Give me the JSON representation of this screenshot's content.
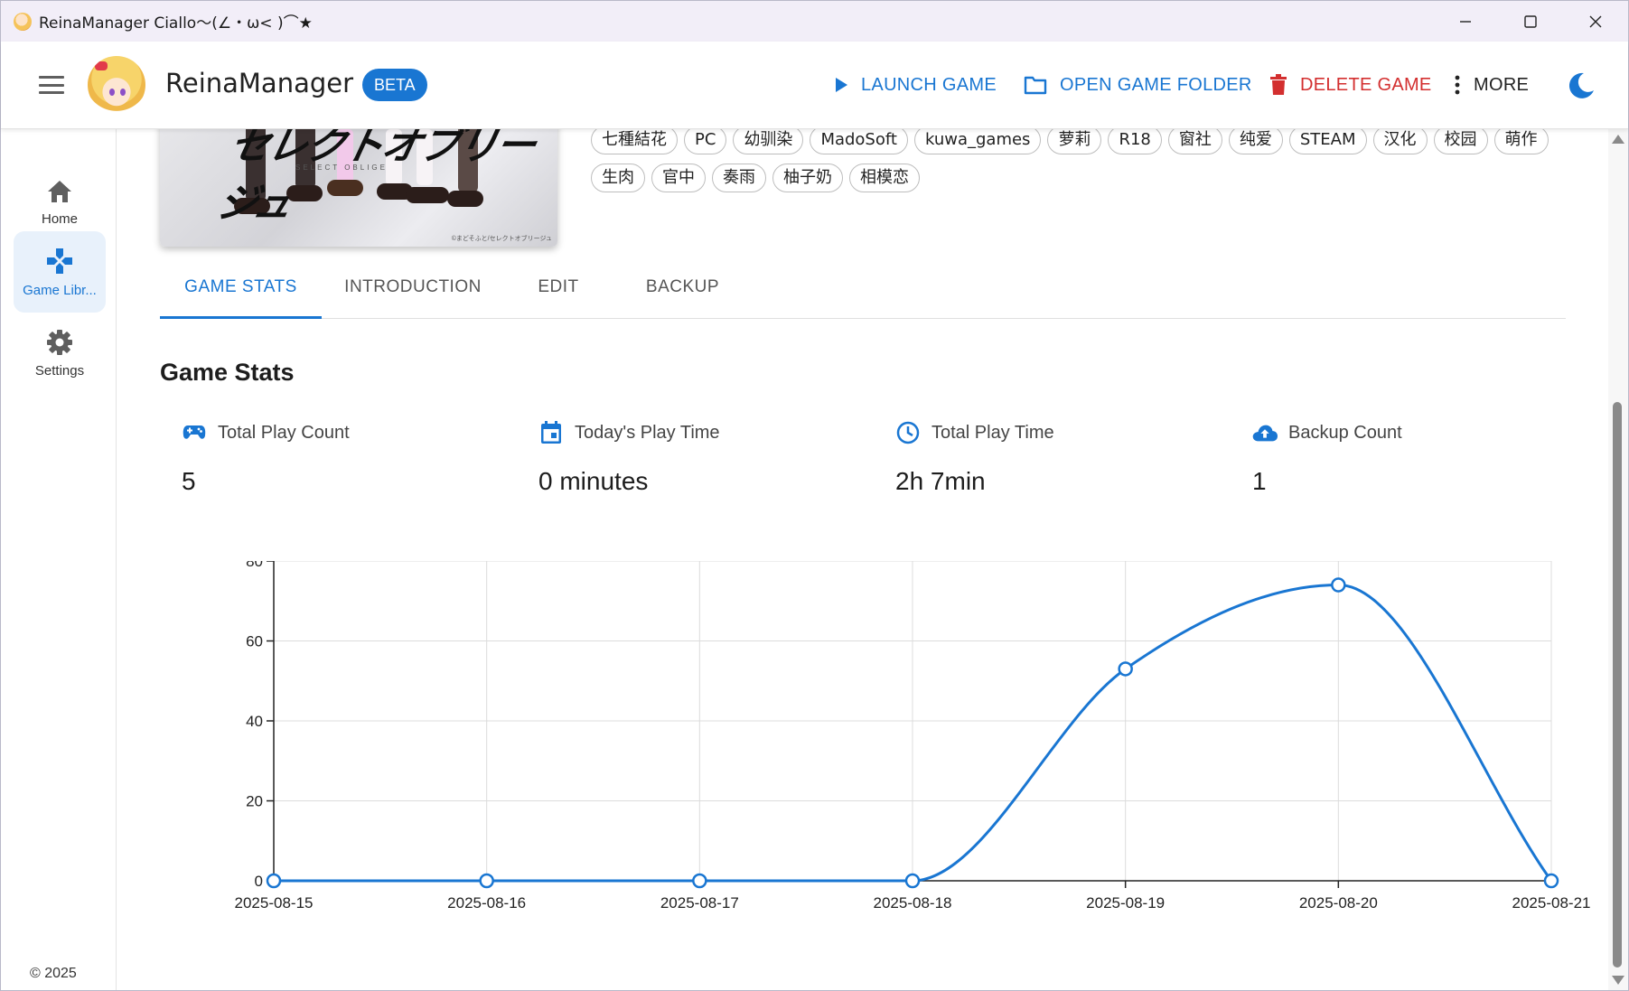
{
  "window": {
    "title": "ReinaManager Ciallo～(∠・ω< )⌒★"
  },
  "appbar": {
    "brand": "ReinaManager",
    "badge": "BETA",
    "actions": {
      "launch": "LAUNCH GAME",
      "open_folder": "OPEN GAME FOLDER",
      "delete": "DELETE GAME",
      "more": "MORE"
    },
    "colors": {
      "primary": "#1976d2",
      "danger": "#d32f2f"
    }
  },
  "sidebar": {
    "items": [
      {
        "label": "Home",
        "icon": "home-icon"
      },
      {
        "label": "Game Libr...",
        "icon": "gamepad-icon",
        "active": true
      },
      {
        "label": "Settings",
        "icon": "gear-icon"
      }
    ],
    "copyright": "© 2025"
  },
  "game": {
    "tags_row1": [
      "七種結花",
      "PC",
      "幼驯染",
      "MadoSoft",
      "kuwa_games",
      "萝莉",
      "R18",
      "窗社",
      "纯爱",
      "STEAM",
      "汉化",
      "校园",
      "萌作"
    ],
    "tags_row2": [
      "生肉",
      "官中",
      "奏雨",
      "柚子奶",
      "相模恋"
    ],
    "cover_title": "セレクトオブリージュ",
    "cover_subtitle": "SELECT OBLIGE",
    "cover_credit": "©まどそふと/セレクトオブリージュ"
  },
  "tabs": [
    {
      "label": "GAME STATS",
      "active": true
    },
    {
      "label": "INTRODUCTION"
    },
    {
      "label": "EDIT"
    },
    {
      "label": "BACKUP"
    }
  ],
  "stats": {
    "title": "Game Stats",
    "items": [
      {
        "label": "Total Play Count",
        "value": "5",
        "icon": "gamepad-icon"
      },
      {
        "label": "Today's Play Time",
        "value": "0 minutes",
        "icon": "calendar-icon"
      },
      {
        "label": "Total Play Time",
        "value": "2h 7min",
        "icon": "clock-icon"
      },
      {
        "label": "Backup Count",
        "value": "1",
        "icon": "cloud-upload-icon"
      }
    ]
  },
  "chart_data": {
    "type": "line",
    "categories": [
      "2025-08-15",
      "2025-08-16",
      "2025-08-17",
      "2025-08-18",
      "2025-08-19",
      "2025-08-20",
      "2025-08-21"
    ],
    "values": [
      0,
      0,
      0,
      0,
      53,
      74,
      0
    ],
    "ylim": [
      0,
      80
    ],
    "yticks": [
      0,
      20,
      40,
      60,
      80
    ],
    "grid": true,
    "line_color": "#1976d2",
    "smooth": true
  }
}
